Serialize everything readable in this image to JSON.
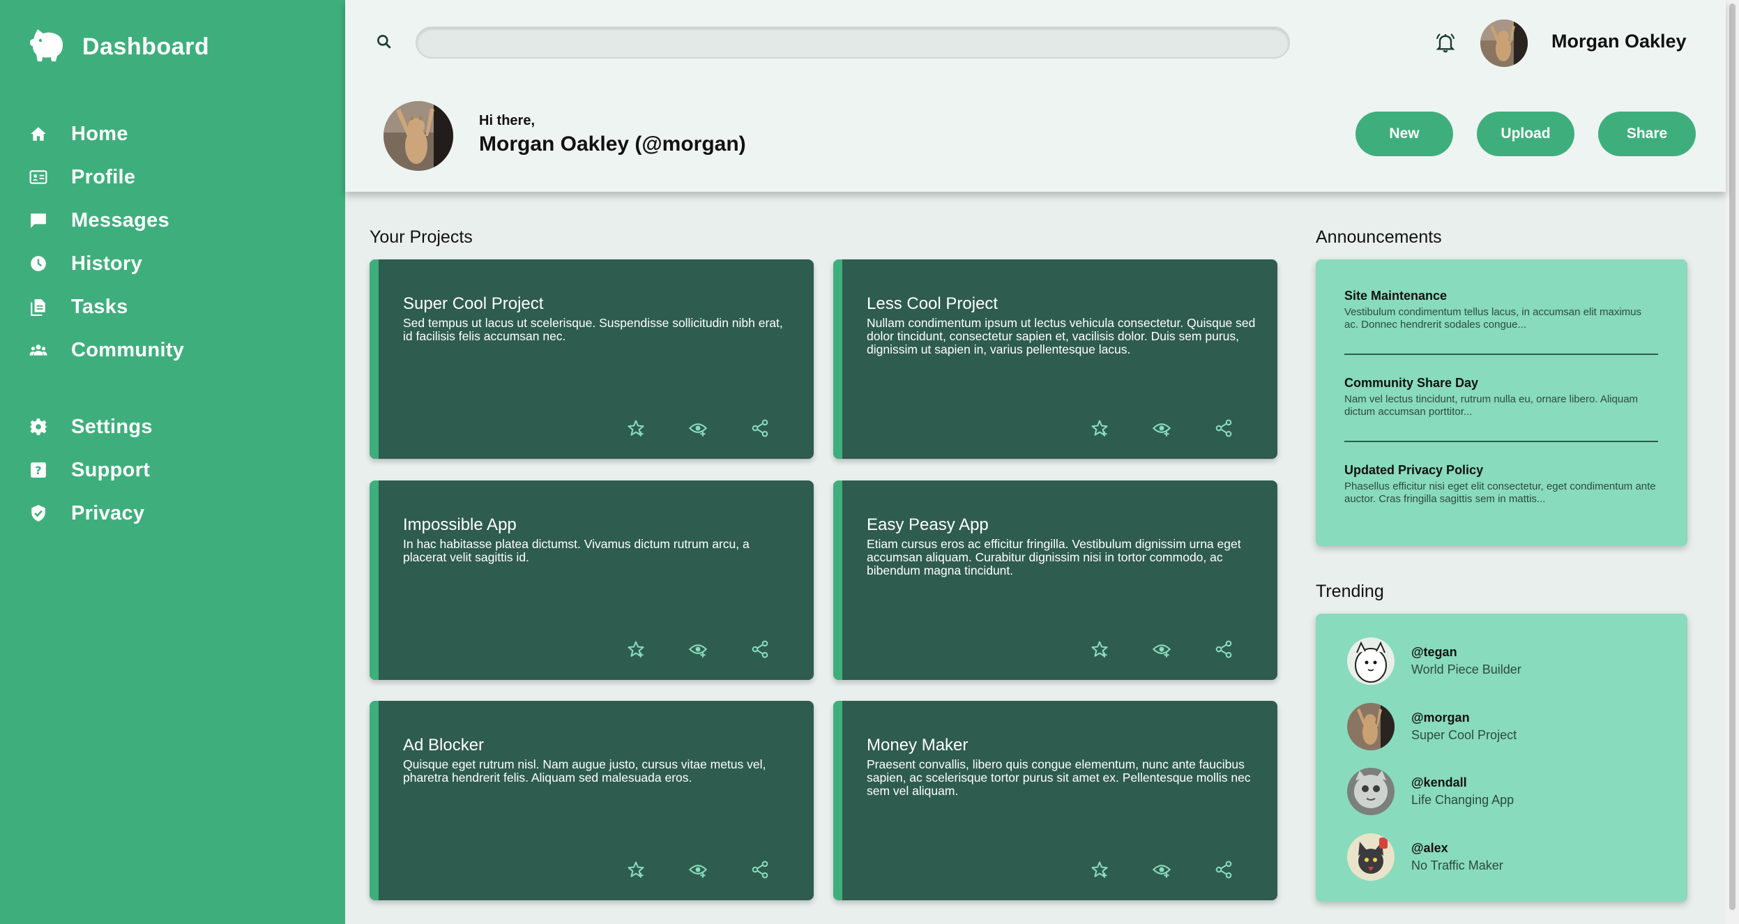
{
  "app": {
    "brand_title": "Dashboard",
    "brand_icon": "piggy-bank-icon"
  },
  "colors": {
    "sidebar": "#3eaf7c",
    "accent": "#3eaf7c",
    "card_bg": "#2e5c4e",
    "panel_bg": "#88dbbd",
    "page_bg": "#e9efed"
  },
  "sidebar": {
    "items": [
      {
        "label": "Home",
        "icon": "home-icon"
      },
      {
        "label": "Profile",
        "icon": "id-card-icon"
      },
      {
        "label": "Messages",
        "icon": "chat-icon"
      },
      {
        "label": "History",
        "icon": "clock-icon"
      },
      {
        "label": "Tasks",
        "icon": "document-icon"
      },
      {
        "label": "Community",
        "icon": "people-icon"
      }
    ],
    "items_secondary": [
      {
        "label": "Settings",
        "icon": "gear-icon"
      },
      {
        "label": "Support",
        "icon": "help-icon"
      },
      {
        "label": "Privacy",
        "icon": "shield-icon"
      }
    ]
  },
  "header": {
    "search_placeholder": "",
    "user_name": "Morgan Oakley",
    "greeting": "Hi there,",
    "handle": "Morgan Oakley (@morgan)",
    "buttons": {
      "new": "New",
      "upload": "Upload",
      "share": "Share"
    }
  },
  "projects": {
    "title": "Your Projects",
    "items": [
      {
        "title": "Super Cool Project",
        "desc": "Sed tempus ut lacus ut scelerisque. Suspendisse sollicitudin nibh erat, id facilisis felis accumsan nec."
      },
      {
        "title": "Less Cool Project",
        "desc": "Nullam condimentum ipsum ut lectus vehicula consectetur. Quisque sed dolor tincidunt, consectetur sapien et, vacilisis dolor. Duis sem purus, dignissim ut sapien in, varius pellentesque lacus."
      },
      {
        "title": "Impossible App",
        "desc": "In hac habitasse platea dictumst. Vivamus dictum rutrum arcu, a placerat velit sagittis id."
      },
      {
        "title": "Easy Peasy App",
        "desc": "Etiam cursus eros ac efficitur fringilla. Vestibulum dignissim urna eget accumsan aliquam. Curabitur dignissim nisi in tortor commodo, ac bibendum magna tincidunt."
      },
      {
        "title": "Ad Blocker",
        "desc": "Quisque eget rutrum nisl. Nam augue justo, cursus vitae metus vel, pharetra hendrerit felis. Aliquam sed malesuada eros."
      },
      {
        "title": "Money Maker",
        "desc": "Praesent convallis, libero quis congue elementum, nunc ante faucibus sapien, ac scelerisque tortor purus sit amet ex. Pellentesque mollis nec sem vel aliquam."
      }
    ]
  },
  "announcements": {
    "title": "Announcements",
    "items": [
      {
        "title": "Site Maintenance",
        "text": "Vestibulum condimentum tellus lacus, in accumsan elit maximus ac. Donnec hendrerit sodales congue..."
      },
      {
        "title": "Community Share Day",
        "text": "Nam vel lectus tincidunt, rutrum nulla eu, ornare libero. Aliquam dictum accumsan porttitor..."
      },
      {
        "title": "Updated Privacy Policy",
        "text": "Phasellus efficitur nisi eget elit consectetur, eget condimentum ante auctor. Cras fringilla sagittis sem in mattis..."
      }
    ]
  },
  "trending": {
    "title": "Trending",
    "items": [
      {
        "name": "@tegan",
        "project": "World Piece Builder"
      },
      {
        "name": "@morgan",
        "project": "Super Cool Project"
      },
      {
        "name": "@kendall",
        "project": "Life Changing App"
      },
      {
        "name": "@alex",
        "project": "No Traffic Maker"
      }
    ]
  }
}
